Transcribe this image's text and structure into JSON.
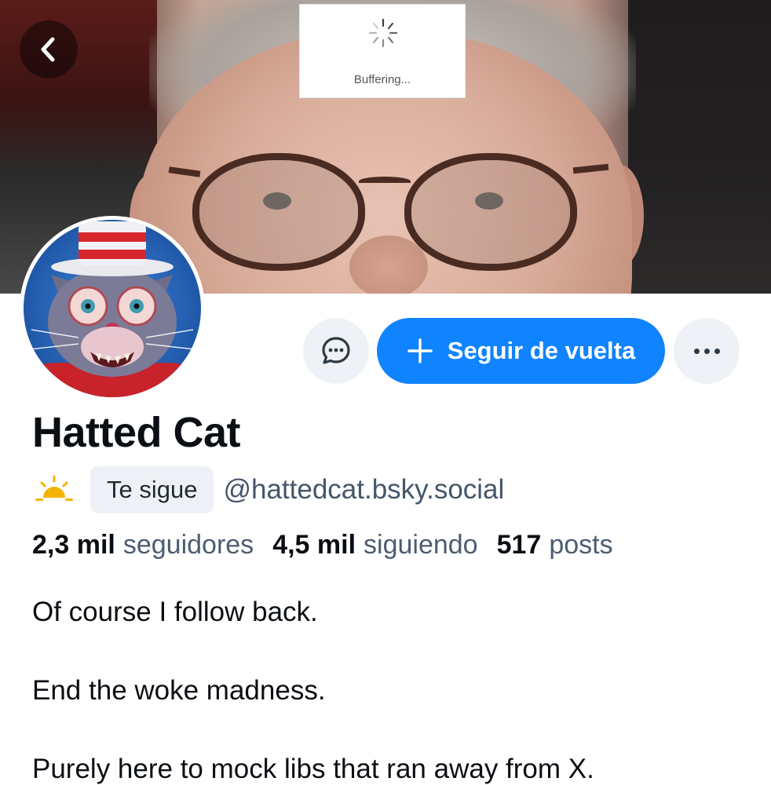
{
  "banner": {
    "buffering_label": "Buffering..."
  },
  "profile": {
    "display_name": "Hatted Cat",
    "follows_you_label": "Te sigue",
    "handle": "@hattedcat.bsky.social"
  },
  "actions": {
    "follow_back_label": "Seguir de vuelta"
  },
  "stats": {
    "followers_count": "2,3 mil",
    "followers_label": "seguidores",
    "following_count": "4,5 mil",
    "following_label": "siguiendo",
    "posts_count": "517",
    "posts_label": "posts"
  },
  "bio": {
    "line1": "Of course I follow back.",
    "line2": "End the woke madness.",
    "line3": "Purely here to mock libs that ran away from X."
  },
  "colors": {
    "accent": "#1083fe",
    "secondary_text": "#44566b",
    "button_bg": "#eef2f6"
  },
  "icons": {
    "back": "chevron-left-icon",
    "message": "chat-bubble-icon",
    "more": "ellipsis-icon",
    "sun": "sunrise-icon"
  }
}
